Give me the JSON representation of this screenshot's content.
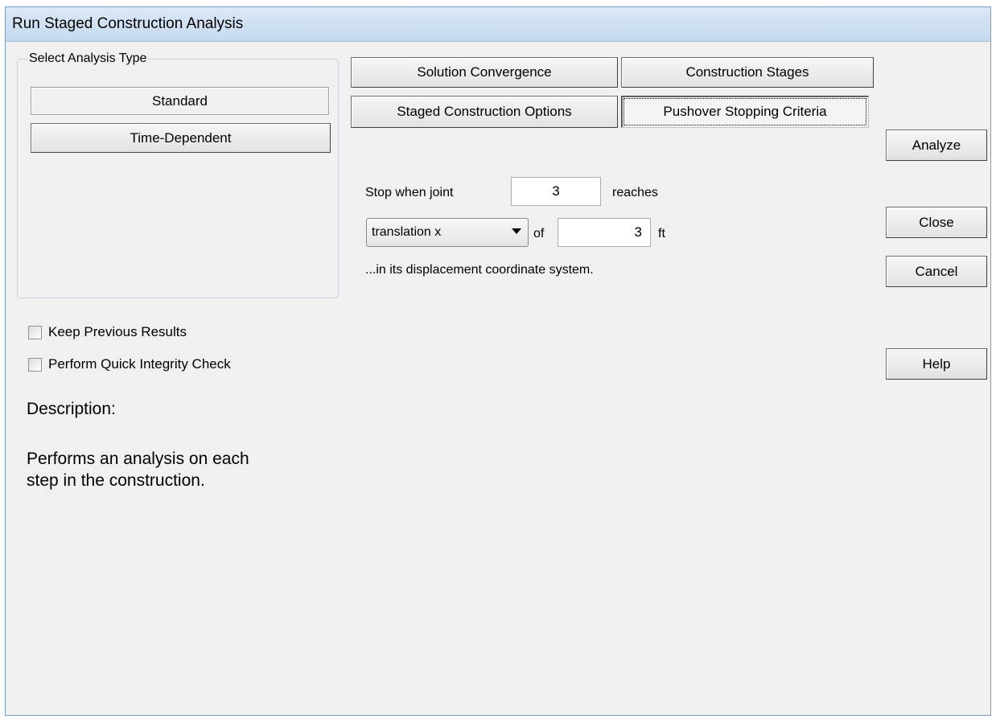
{
  "window": {
    "title": "Run Staged Construction Analysis"
  },
  "analysis_type": {
    "legend": "Select Analysis Type",
    "options": [
      {
        "label": "Standard",
        "selected": true
      },
      {
        "label": "Time-Dependent",
        "selected": false
      }
    ]
  },
  "tabs": [
    {
      "label": "Solution Convergence"
    },
    {
      "label": "Construction Stages"
    },
    {
      "label": "Staged Construction Options"
    },
    {
      "label": "Pushover Stopping Criteria",
      "active": true
    }
  ],
  "stopping": {
    "stop_label": "Stop when joint",
    "joint_value": "3",
    "reaches_label": "reaches",
    "dof_selected": "translation x",
    "of_label": "of",
    "amount_value": "3",
    "unit": "ft",
    "note": "...in its displacement coordinate system."
  },
  "actions": {
    "analyze": "Analyze",
    "close": "Close",
    "cancel": "Cancel",
    "help": "Help"
  },
  "options": {
    "keep_previous": {
      "label": "Keep Previous Results",
      "checked": false
    },
    "quick_check": {
      "label": "Perform Quick Integrity Check",
      "checked": false
    }
  },
  "description": {
    "heading": "Description:",
    "line1": "Performs an analysis on each",
    "line2": "step in the construction."
  }
}
